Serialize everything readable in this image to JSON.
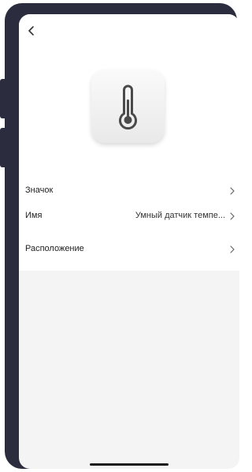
{
  "header": {
    "back_icon": "chevron-left-icon"
  },
  "device": {
    "icon": "thermometer-icon"
  },
  "settings": {
    "icon_label": "Значок",
    "name_label": "Имя",
    "name_value": "Умный датчик темпе...",
    "location_label": "Расположение"
  },
  "colors": {
    "frame": "#2b2d3f",
    "background": "#f4f4f4",
    "surface": "#ffffff"
  }
}
